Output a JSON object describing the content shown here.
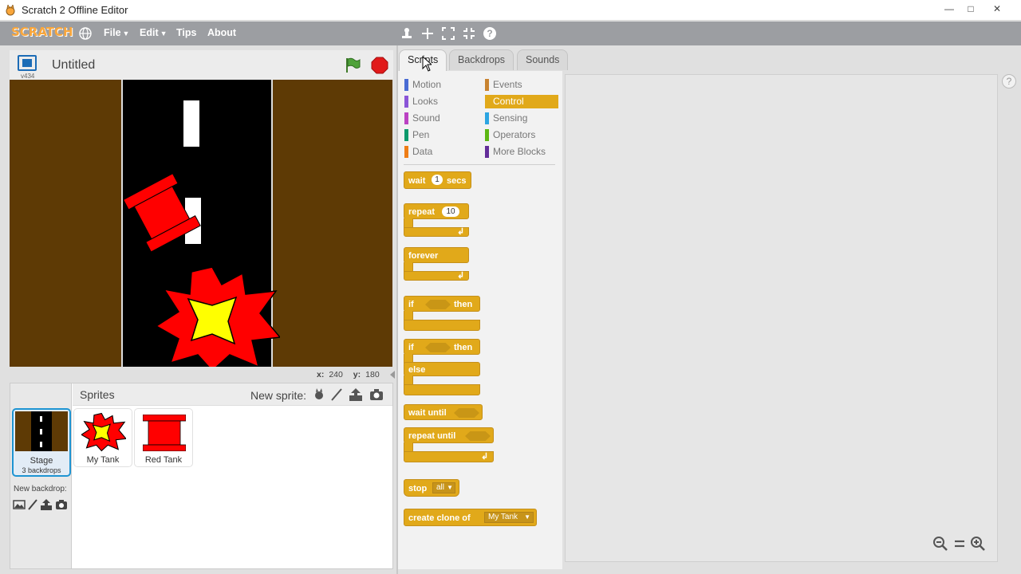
{
  "window": {
    "title": "Scratch 2 Offline Editor",
    "minimize": "—",
    "maximize": "□",
    "close": "✕"
  },
  "menubar": {
    "logo": "SCRATCH",
    "file": "File",
    "edit": "Edit",
    "tips": "Tips",
    "about": "About"
  },
  "stage": {
    "version": "v434",
    "project_title": "Untitled",
    "coords_x_label": "x:",
    "coords_x": "240",
    "coords_y_label": "y:",
    "coords_y": "180"
  },
  "sprites": {
    "title": "Sprites",
    "new_sprite_label": "New sprite:",
    "stage_label": "Stage",
    "stage_backdrops": "3 backdrops",
    "new_backdrop_label": "New backdrop:",
    "items": [
      {
        "label": "My Tank"
      },
      {
        "label": "Red Tank"
      }
    ]
  },
  "tabs": {
    "scripts": "Scripts",
    "backdrops": "Backdrops",
    "sounds": "Sounds"
  },
  "categories": [
    {
      "label": "Motion",
      "color": "#4a6cd4"
    },
    {
      "label": "Looks",
      "color": "#8a55d7"
    },
    {
      "label": "Sound",
      "color": "#bb42c3"
    },
    {
      "label": "Pen",
      "color": "#0e9a6c"
    },
    {
      "label": "Data",
      "color": "#ee7d16"
    },
    {
      "label": "Events",
      "color": "#c88330"
    },
    {
      "label": "Control",
      "color": "#e1a91a"
    },
    {
      "label": "Sensing",
      "color": "#2ca5e2"
    },
    {
      "label": "Operators",
      "color": "#5cb712"
    },
    {
      "label": "More Blocks",
      "color": "#632d99"
    }
  ],
  "blocks": {
    "wait": "wait",
    "wait_value": "1",
    "wait_unit": "secs",
    "repeat": "repeat",
    "repeat_value": "10",
    "forever": "forever",
    "if1": "if",
    "then1": "then",
    "if2": "if",
    "then2": "then",
    "else": "else",
    "wait_until": "wait until",
    "repeat_until": "repeat until",
    "stop": "stop",
    "stop_option": "all",
    "create_clone": "create clone of",
    "clone_option": "My Tank"
  },
  "colors": {
    "control": "#e1a91a",
    "menubar": "#9c9ea2",
    "stage_ground": "#5e3a05",
    "tank_red": "#ff0000",
    "explosion_yellow": "#ffff00"
  }
}
